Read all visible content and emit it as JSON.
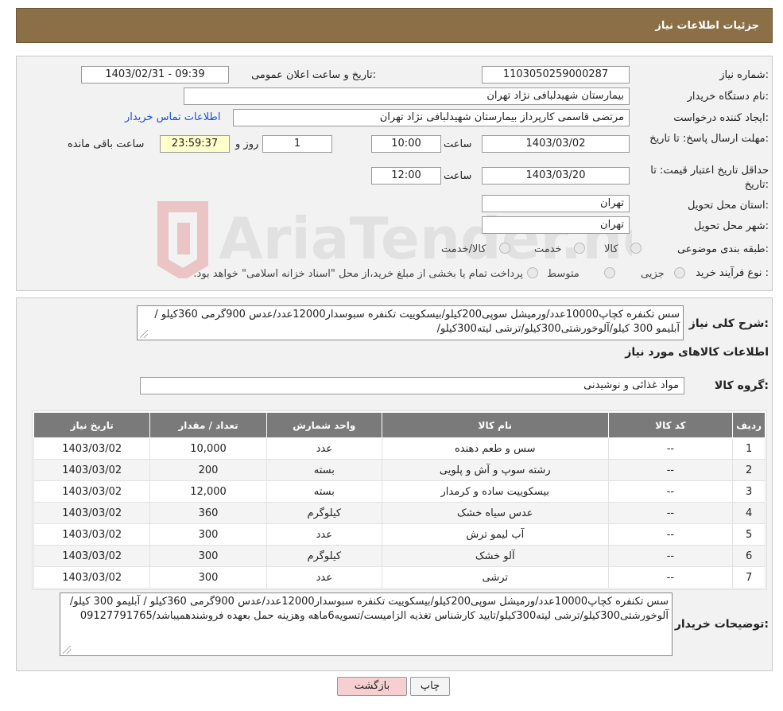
{
  "header": {
    "title": "جزئیات اطلاعات نیاز"
  },
  "form": {
    "need_number_label": "شماره نیاز:",
    "need_number": "1103050259000287",
    "announce_label": "تاریخ و ساعت اعلان عمومی:",
    "announce_value": "1403/02/31 - 09:39",
    "buyer_org_label": "نام دستگاه خریدار:",
    "buyer_org": "بیمارستان شهیدلبافی نژاد تهران",
    "requester_label": "ایجاد کننده درخواست:",
    "requester": "مرتضی  قاسمی کارپرداز بیمارستان شهیدلبافی نژاد تهران",
    "contact_link": "اطلاعات تماس خریدار",
    "deadline_label": "مهلت ارسال پاسخ: تا تاریخ:",
    "deadline_date": "1403/03/02",
    "time_label": "ساعت",
    "deadline_time": "10:00",
    "days_value": "1",
    "days_label": "روز و",
    "remaining_time": "23:59:37",
    "remaining_label": "ساعت باقی مانده",
    "validity_label": "حداقل تاریخ اعتبار قیمت: تا تاریخ:",
    "validity_date": "1403/03/20",
    "validity_time": "12:00",
    "province_label": "استان محل تحویل:",
    "province": "تهران",
    "city_label": "شهر محل تحویل:",
    "city": "تهران",
    "category_label": "طبقه بندی موضوعی:",
    "category_options": [
      "کالا",
      "خدمت",
      "کالا/خدمت"
    ],
    "process_label": "نوع فرآیند خرید :",
    "process_options": [
      "جزیی",
      "متوسط"
    ],
    "process_note": "پرداخت تمام یا بخشی از مبلغ خرید،از محل \"اسناد خزانه اسلامی\" خواهد بود."
  },
  "description": {
    "label": "شرح کلی نیاز:",
    "text": "سس تکنفره کچاپ10000عدد/ورمیشل سوپی200کیلو/بیسکوییت تکنفره سبوسدار12000عدد/عدس 900گرمی 360کیلو /آبلیمو 300 کیلو/آلوخورشتی300کیلو/ترشی لیته300کیلو/"
  },
  "items_section": {
    "title": "اطلاعات کالاهای مورد نیاز",
    "group_label": "گروه کالا:",
    "group_value": "مواد غذائی و نوشیدنی",
    "columns": [
      "ردیف",
      "کد کالا",
      "نام کالا",
      "واحد شمارش",
      "تعداد / مقدار",
      "تاریخ نیاز"
    ],
    "rows": [
      [
        "1",
        "--",
        "سس و طعم دهنده",
        "عدد",
        "10,000",
        "1403/03/02"
      ],
      [
        "2",
        "--",
        "رشته سوپ و آش و پلویی",
        "بسته",
        "200",
        "1403/03/02"
      ],
      [
        "3",
        "--",
        "بیسکوییت ساده و کرمدار",
        "بسته",
        "12,000",
        "1403/03/02"
      ],
      [
        "4",
        "--",
        "عدس سیاه خشک",
        "کیلوگرم",
        "360",
        "1403/03/02"
      ],
      [
        "5",
        "--",
        "آب لیمو ترش",
        "عدد",
        "300",
        "1403/03/02"
      ],
      [
        "6",
        "--",
        "آلو خشک",
        "کیلوگرم",
        "300",
        "1403/03/02"
      ],
      [
        "7",
        "--",
        "ترشی",
        "عدد",
        "300",
        "1403/03/02"
      ]
    ]
  },
  "buyer_notes": {
    "label": "توضیحات خریدار:",
    "text": "سس تکنفره کچاپ10000عدد/ورمیشل سوپی200کیلو/بیسکوییت تکنفره سبوسدار12000عدد/عدس 900گرمی 360کیلو / آبلیمو 300 کیلو/آلوخورشتی300کیلو/ترشی لیته300کیلو/تایید کارشناس تغذیه الزامیست/تسویه6ماهه وهزینه حمل بعهده فروشندهمیباشد/09127791765"
  },
  "buttons": {
    "print": "چاپ",
    "back": "بازگشت"
  },
  "watermark": {
    "text": "AriaTender.neT"
  },
  "colors": {
    "header": "#8b6f47",
    "back_button": "#f6d0d0",
    "table_header": "#7a7a7a"
  }
}
